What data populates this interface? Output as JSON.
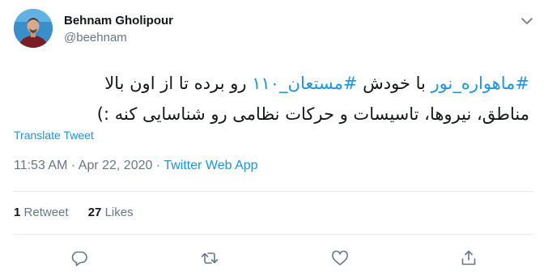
{
  "author": {
    "display_name": "Behnam Gholipour",
    "handle": "@beehnam"
  },
  "tweet": {
    "line1": {
      "hashtag1": "#ماهواره_نور",
      "text1": " با خودش ",
      "hashtag2": "#مستعان_۱۱۰",
      "text2": " رو برده تا از اون بالا"
    },
    "line2": "مناطق، نیروها، تاسیسات و حرکات نظامی رو شناسایی کنه :)",
    "translate_label": "Translate Tweet"
  },
  "meta": {
    "time": "11:53 AM",
    "separator1": " · ",
    "date": "Apr 22, 2020",
    "separator2": " · ",
    "source": "Twitter Web App"
  },
  "stats": {
    "retweets_count": "1",
    "retweets_label": "Retweet",
    "likes_count": "27",
    "likes_label": "Likes"
  },
  "icons": {
    "caret": "chevron-down-icon",
    "reply": "reply-icon",
    "retweet": "retweet-icon",
    "like": "heart-icon",
    "share": "share-icon"
  },
  "colors": {
    "link": "#1b95e0",
    "text": "#14171a",
    "muted": "#657786",
    "divider": "#e6ecf0"
  }
}
